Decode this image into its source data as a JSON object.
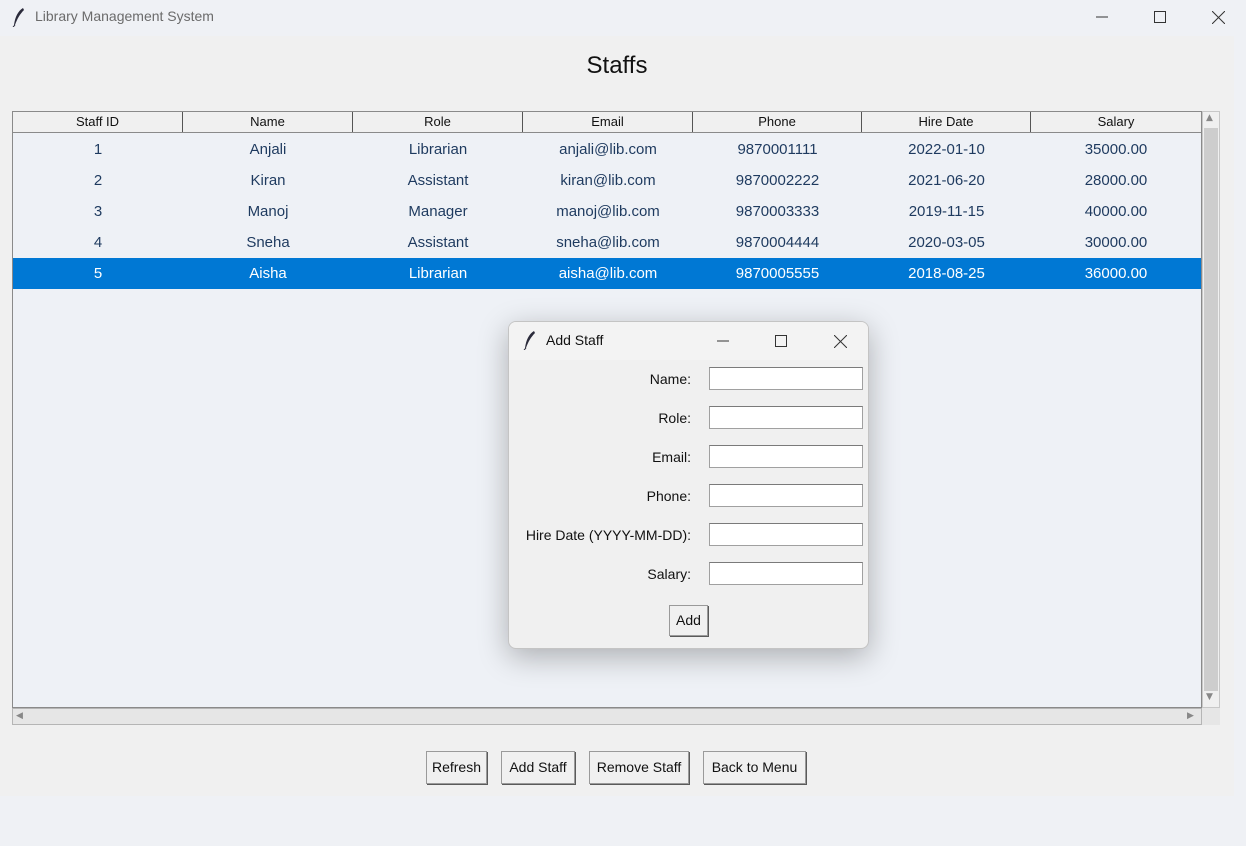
{
  "window": {
    "title": "Library Management System",
    "icon": "feather-icon"
  },
  "page": {
    "title": "Staffs"
  },
  "table": {
    "columns": [
      "Staff ID",
      "Name",
      "Role",
      "Email",
      "Phone",
      "Hire Date",
      "Salary"
    ],
    "rows": [
      [
        "1",
        "Anjali",
        "Librarian",
        "anjali@lib.com",
        "9870001111",
        "2022-01-10",
        "35000.00"
      ],
      [
        "2",
        "Kiran",
        "Assistant",
        "kiran@lib.com",
        "9870002222",
        "2021-06-20",
        "28000.00"
      ],
      [
        "3",
        "Manoj",
        "Manager",
        "manoj@lib.com",
        "9870003333",
        "2019-11-15",
        "40000.00"
      ],
      [
        "4",
        "Sneha",
        "Assistant",
        "sneha@lib.com",
        "9870004444",
        "2020-03-05",
        "30000.00"
      ],
      [
        "5",
        "Aisha",
        "Librarian",
        "aisha@lib.com",
        "9870005555",
        "2018-08-25",
        "36000.00"
      ]
    ],
    "selected_row": 4,
    "selection_color": "#0078d4"
  },
  "buttons": {
    "refresh": "Refresh",
    "add_staff": "Add Staff",
    "remove_staff": "Remove Staff",
    "back_to_menu": "Back to Menu"
  },
  "dialog": {
    "title": "Add Staff",
    "fields": [
      {
        "label": "Name:",
        "value": ""
      },
      {
        "label": "Role:",
        "value": ""
      },
      {
        "label": "Email:",
        "value": ""
      },
      {
        "label": "Phone:",
        "value": ""
      },
      {
        "label": "Hire Date (YYYY-MM-DD):",
        "value": ""
      },
      {
        "label": "Salary:",
        "value": ""
      }
    ],
    "submit_label": "Add"
  }
}
